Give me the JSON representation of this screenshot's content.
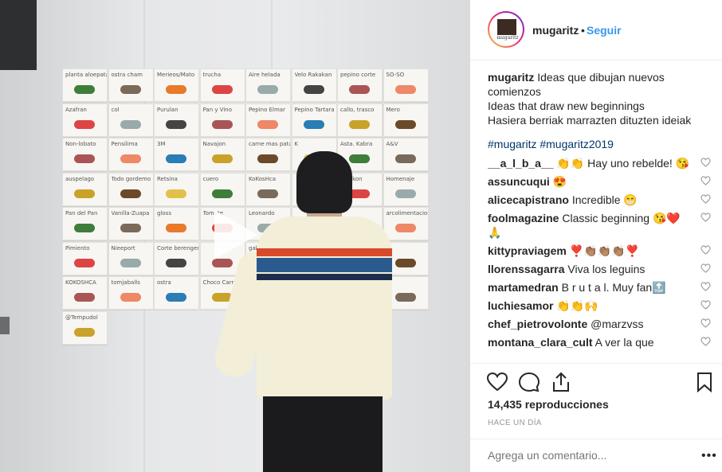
{
  "post": {
    "username": "mugaritz",
    "separator": "•",
    "follow_label": "Seguir",
    "avatar_text": "mugaritz"
  },
  "caption": {
    "username": "mugaritz",
    "lines": [
      "Ideas que dibujan nuevos comienzos",
      "Ideas that draw new beginnings",
      "Hasiera berriak marrazten dituzten ideiak"
    ],
    "hashtags": "#mugaritz #mugaritz2019"
  },
  "comments": [
    {
      "user": "__a_l_b_a__",
      "text": "👏👏 Hay uno rebelde! 😘"
    },
    {
      "user": "assuncuqui",
      "text": "😍"
    },
    {
      "user": "alicecapistrano",
      "text": "Incredible 😁"
    },
    {
      "user": "foolmagazine",
      "text": "Classic beginning 😘❤️🙏"
    },
    {
      "user": "kittypraviagem",
      "text": "❣️👏🏽👏🏽👏🏽❣️"
    },
    {
      "user": "llorenssagarra",
      "text": "Viva los leguins"
    },
    {
      "user": "martamedran",
      "text": "B r u t a l. Muy fan🔝"
    },
    {
      "user": "luchiesamor",
      "text": "👏👏🙌"
    },
    {
      "user": "chef_pietrovolonte",
      "text": "@marzvss"
    },
    {
      "user": "montana_clara_cult",
      "text": "A ver la que"
    }
  ],
  "stats": {
    "views": "14,435 reproducciones",
    "time": "Hace un día"
  },
  "add_comment": {
    "placeholder": "Agrega un comentario..."
  },
  "more_label": "•••",
  "cards": [
    [
      "planta aloepatam",
      "ostra cham",
      "Merieos/Mato",
      "trucha",
      "Aire helada",
      "Velo Rakakan",
      "pepino corte",
      "SO-SO"
    ],
    [
      "Azafran",
      "col",
      "Purulan",
      "Pan y Vino",
      "Pepino Elmar",
      "Pepino Tartara",
      "callo, trasco",
      "Mero"
    ],
    [
      "Non-lobato",
      "Pensilima",
      "3M",
      "Navajon",
      "carne mas patata",
      "K",
      "Asta. Kabra",
      "A&V"
    ],
    [
      "auspelago",
      "Todo gordemo",
      "Retsina",
      "cuero",
      "KoKosHca",
      "",
      "Pomkon",
      "Homenaje"
    ],
    [
      "Pan del Pan",
      "Vanilla-Zuapa",
      "gloss",
      "Tomate",
      "Leonardo",
      "",
      "",
      "arcolimentacion"
    ],
    [
      "Pimiento",
      "Nieeport",
      "Corte berengena",
      "",
      "galtacoche",
      "",
      "",
      ""
    ],
    [
      "KOKOSHCA",
      "tomjaballs",
      "ostra",
      "Choco Carra",
      "",
      "",
      "",
      ""
    ],
    [
      "@Tempudol",
      "",
      "",
      "",
      "",
      "",
      "",
      ""
    ]
  ],
  "colors": {
    "accent": "#3897f0",
    "hashtag": "#003569",
    "muted": "#999999"
  }
}
